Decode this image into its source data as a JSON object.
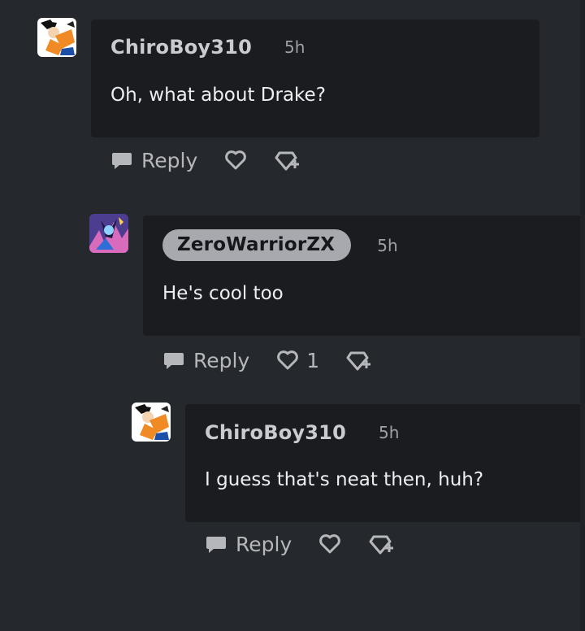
{
  "comments": [
    {
      "username": "ChiroBoy310",
      "time": "5h",
      "text": "Oh, what about Drake?",
      "reply_label": "Reply",
      "like_count": ""
    },
    {
      "username": "ZeroWarriorZX",
      "time": "5h",
      "text": "He's cool too",
      "reply_label": "Reply",
      "like_count": "1"
    },
    {
      "username": "ChiroBoy310",
      "time": "5h",
      "text": "I guess that's neat then, huh?",
      "reply_label": "Reply",
      "like_count": ""
    }
  ],
  "icons": {
    "reply": "speech-bubble-icon",
    "like": "heart-icon",
    "award": "award-plus-icon"
  },
  "colors": {
    "background": "#25282c",
    "bubble": "#1a1c20",
    "highlight_pill": "#a7a9ae",
    "avatar_orange": "#f08a24"
  }
}
